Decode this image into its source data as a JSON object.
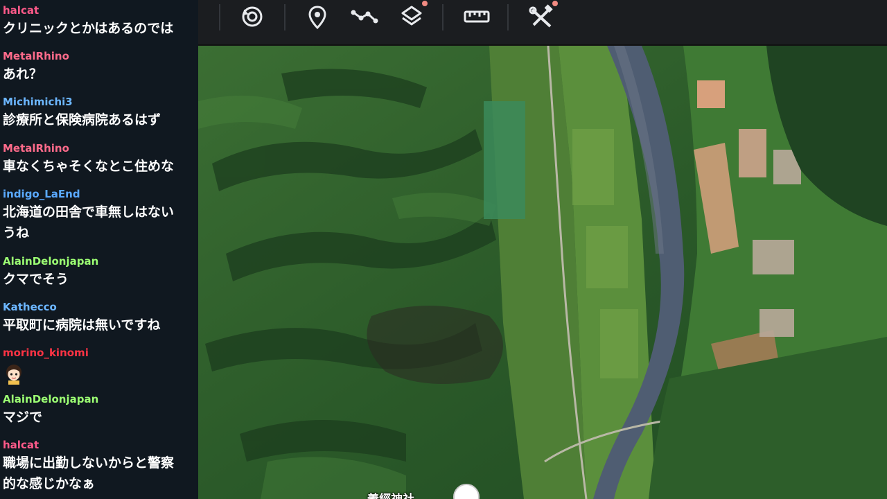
{
  "chat": {
    "messages": [
      {
        "user": "halcat",
        "color": "#ff5a8a",
        "lines": [
          "クリニックとかはあるのでは"
        ]
      },
      {
        "user": "MetalRhino",
        "color": "#ff6b8b",
        "lines": [
          "あれ？"
        ]
      },
      {
        "user": "Michimichi3",
        "color": "#6cb6ff",
        "lines": [
          "診療所と保険病院あるはず"
        ]
      },
      {
        "user": "MetalRhino",
        "color": "#ff6b8b",
        "lines": [
          "車なくちゃそくなとこ住めな"
        ]
      },
      {
        "user": "indigo_LaEnd",
        "color": "#5aa9ff",
        "lines": [
          "北海道の田舎で車無しはない",
          "うね"
        ]
      },
      {
        "user": "AlainDelonjapan",
        "color": "#9cff73",
        "lines": [
          "クマでそう"
        ]
      },
      {
        "user": "Kathecco",
        "color": "#6cb6ff",
        "lines": [
          "平取町に病院は無いですね"
        ]
      },
      {
        "user": "morino_kinomi",
        "color": "#ff3344",
        "lines": [],
        "emote": "character-emote"
      },
      {
        "user": "AlainDelonjapan",
        "color": "#9cff73",
        "lines": [
          "マジで"
        ]
      },
      {
        "user": "halcat",
        "color": "#ff5a8a",
        "lines": [
          "職場に出勤しないからと警察",
          "的な感じかなぁ"
        ]
      }
    ]
  },
  "toolbar": {
    "buttons": [
      {
        "name": "history-icon",
        "has_dot": false
      },
      {
        "name": "map-pin-icon",
        "has_dot": false
      },
      {
        "name": "path-icon",
        "has_dot": false
      },
      {
        "name": "layers-icon",
        "has_dot": true
      },
      {
        "name": "ruler-icon",
        "has_dot": false
      },
      {
        "name": "measure-tools-icon",
        "has_dot": true
      }
    ],
    "icon_color": "#e8eaed",
    "dot_color": "#f28b82"
  },
  "map": {
    "place_label": "義經神社",
    "colors": {
      "forest": "#2c5a2a",
      "river": "#4f5d72",
      "field": "#5b8f3c",
      "bare_soil": "#c19a73"
    }
  }
}
